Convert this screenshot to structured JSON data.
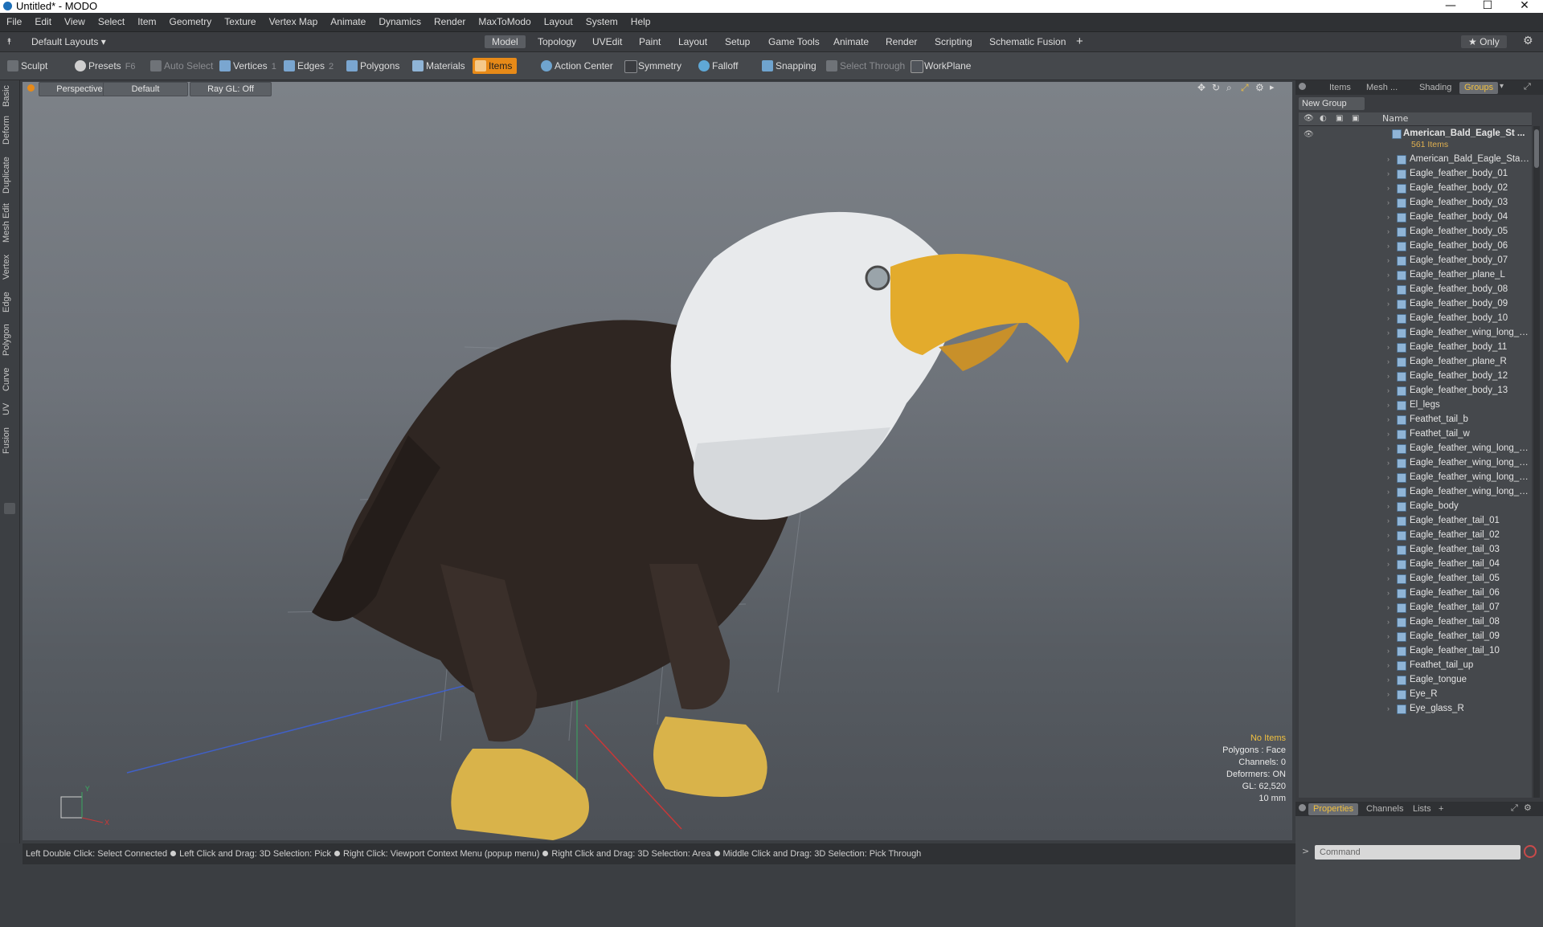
{
  "window": {
    "title": "Untitled* - MODO",
    "controls": {
      "minimize": "—",
      "maximize": "☐",
      "close": "✕"
    }
  },
  "menu": [
    "File",
    "Edit",
    "View",
    "Select",
    "Item",
    "Geometry",
    "Texture",
    "Vertex Map",
    "Animate",
    "Dynamics",
    "Render",
    "MaxToModo",
    "Layout",
    "System",
    "Help"
  ],
  "layouts": {
    "dropdown": "Default Layouts ▾",
    "tabs": [
      "Model",
      "Topology",
      "UVEdit",
      "Paint",
      "Layout",
      "Setup",
      "Game Tools",
      "Animate",
      "Render",
      "Scripting",
      "Schematic Fusion"
    ],
    "active_tab": "Model",
    "add": "+",
    "only": "★ Only"
  },
  "toolbar": {
    "sculpt": "Sculpt",
    "presets": "Presets",
    "presets_key": "F6",
    "auto_select": "Auto Select",
    "vertices": "Vertices",
    "vertices_key": "1",
    "edges": "Edges",
    "edges_key": "2",
    "polygons": "Polygons",
    "materials": "Materials",
    "items": "Items",
    "action_center": "Action Center",
    "symmetry": "Symmetry",
    "falloff": "Falloff",
    "snapping": "Snapping",
    "select_through": "Select Through",
    "workplane": "WorkPlane"
  },
  "left_tabs": [
    "Basic",
    "Deform",
    "Duplicate",
    "Mesh Edit",
    "Vertex",
    "Edge",
    "Polygon",
    "Curve",
    "UV",
    "Fusion"
  ],
  "viewport": {
    "view": "Perspective",
    "shading": "Default",
    "raygl": "Ray GL: Off",
    "info": {
      "items": "No Items",
      "polygons": "Polygons : Face",
      "channels": "Channels: 0",
      "deformers": "Deformers: ON",
      "gl": "GL: 62,520",
      "scale": "10 mm"
    },
    "axis": {
      "y": "Y",
      "x": "X"
    }
  },
  "statusbar": {
    "hints": [
      "Left Double Click: Select Connected",
      "Left Click and Drag: 3D Selection: Pick",
      "Right Click: Viewport Context Menu (popup menu)",
      "Right Click and Drag: 3D Selection: Area",
      "Middle Click and Drag: 3D Selection: Pick Through"
    ]
  },
  "panel": {
    "tabs": [
      "Items",
      "Mesh ...",
      "Shading",
      "Groups"
    ],
    "active_tab": "Groups",
    "new_group": "New Group",
    "column_name": "Name",
    "root": {
      "name": "American_Bald_Eagle_St ...",
      "count": "561 Items"
    },
    "items": [
      "American_Bald_Eagle_Stan ...",
      "Eagle_feather_body_01",
      "Eagle_feather_body_02",
      "Eagle_feather_body_03",
      "Eagle_feather_body_04",
      "Eagle_feather_body_05",
      "Eagle_feather_body_06",
      "Eagle_feather_body_07",
      "Eagle_feather_plane_L",
      "Eagle_feather_body_08",
      "Eagle_feather_body_09",
      "Eagle_feather_body_10",
      "Eagle_feather_wing_long_0...",
      "Eagle_feather_body_11",
      "Eagle_feather_plane_R",
      "Eagle_feather_body_12",
      "Eagle_feather_body_13",
      "El_legs",
      "Feathet_tail_b",
      "Feathet_tail_w",
      "Eagle_feather_wing_long_4...",
      "Eagle_feather_wing_long_4...",
      "Eagle_feather_wing_long_4...",
      "Eagle_feather_wing_long_4...",
      "Eagle_body",
      "Eagle_feather_tail_01",
      "Eagle_feather_tail_02",
      "Eagle_feather_tail_03",
      "Eagle_feather_tail_04",
      "Eagle_feather_tail_05",
      "Eagle_feather_tail_06",
      "Eagle_feather_tail_07",
      "Eagle_feather_tail_08",
      "Eagle_feather_tail_09",
      "Eagle_feather_tail_10",
      "Feathet_tail_up",
      "Eagle_tongue",
      "Eye_R",
      "Eye_glass_R"
    ],
    "bottom_tabs": [
      "Properties",
      "Channels",
      "Lists",
      "+"
    ],
    "bottom_active": "Properties",
    "command_placeholder": "Command"
  },
  "colors": {
    "accent": "#e78a18",
    "highlight": "#f0c040",
    "viewport_top": "#7d8288",
    "viewport_bottom": "#4c5056"
  }
}
